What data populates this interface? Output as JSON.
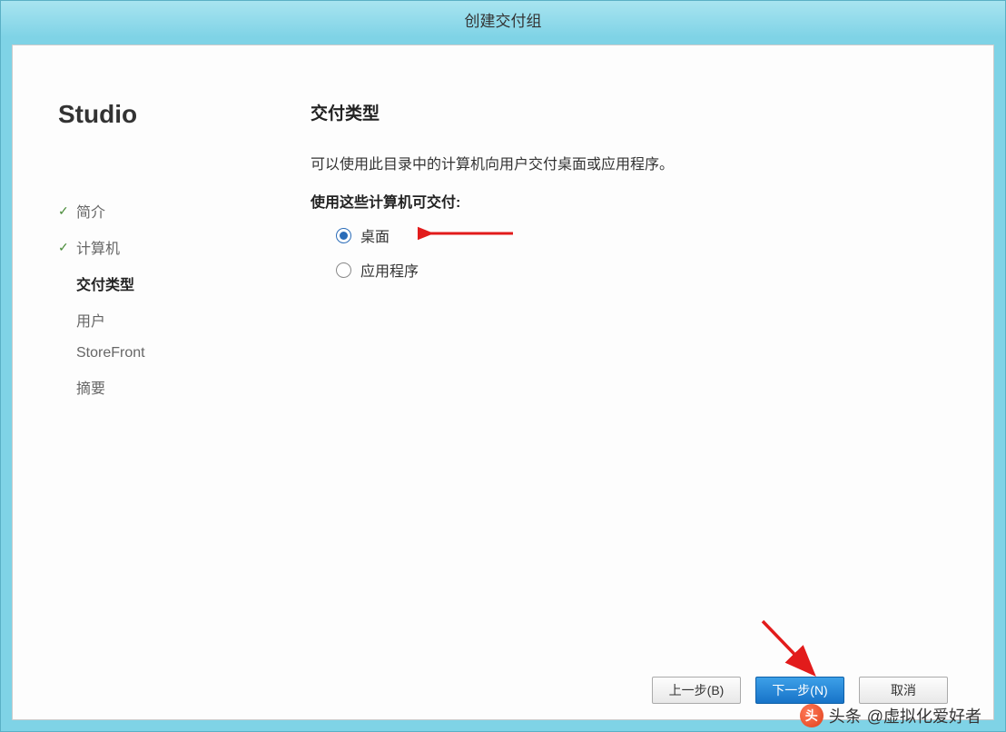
{
  "window": {
    "title": "创建交付组"
  },
  "sidebar": {
    "brand": "Studio",
    "steps": [
      {
        "label": "简介",
        "state": "completed"
      },
      {
        "label": "计算机",
        "state": "completed"
      },
      {
        "label": "交付类型",
        "state": "current"
      },
      {
        "label": "用户",
        "state": "pending"
      },
      {
        "label": "StoreFront",
        "state": "pending"
      },
      {
        "label": "摘要",
        "state": "pending"
      }
    ]
  },
  "content": {
    "heading": "交付类型",
    "description": "可以使用此目录中的计算机向用户交付桌面或应用程序。",
    "subhead": "使用这些计算机可交付:",
    "options": [
      {
        "label": "桌面",
        "selected": true
      },
      {
        "label": "应用程序",
        "selected": false
      }
    ]
  },
  "buttons": {
    "back": "上一步(B)",
    "next": "下一步(N)",
    "cancel": "取消"
  },
  "watermark": {
    "prefix": "头条",
    "handle": "@虚拟化爱好者"
  }
}
